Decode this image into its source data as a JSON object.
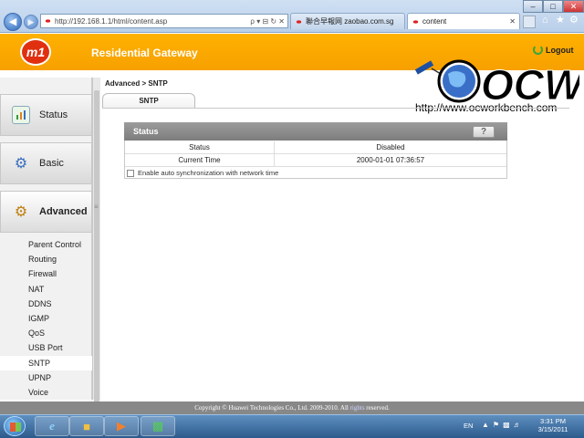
{
  "browser": {
    "url": "http://192.168.1.1/html/content.asp",
    "tab1_label": "聯合早報网 zaobao.com.sg",
    "tab2_label": "content",
    "search_glyphs": "ρ ▾ ⊟ ↻ ✕"
  },
  "router": {
    "title": "Residential Gateway",
    "logo_text": "m1",
    "logout_label": "Logout"
  },
  "watermark": {
    "brand": "OCW",
    "url": "http://www.ocworkbench.com"
  },
  "sidebar": {
    "main_items": [
      {
        "label": "Status",
        "icon": "chart-icon"
      },
      {
        "label": "Basic",
        "icon": "gear-icon"
      },
      {
        "label": "Advanced",
        "icon": "wrench-gear-icon"
      }
    ],
    "sub_items": [
      "Parent Control",
      "Routing",
      "Firewall",
      "NAT",
      "DDNS",
      "IGMP",
      "QoS",
      "USB Port",
      "SNTP",
      "UPNP",
      "Voice"
    ],
    "active_sub": "SNTP"
  },
  "content": {
    "breadcrumb": "Advanced > SNTP",
    "tab_label": "SNTP",
    "panel_title": "Status",
    "help_label": "?",
    "rows": [
      {
        "label": "Status",
        "value": "Disabled"
      },
      {
        "label": "Current Time",
        "value": "2000-01-01 07:36:57"
      }
    ],
    "auto_sync_label": "Enable auto synchronization with network time",
    "auto_sync_checked": false
  },
  "footer": {
    "copyright_pre": "Copyright © Huawei Technologies Co., Ltd. 2009-2010. All",
    "copyright_rights": "rights",
    "copyright_post": "reserved."
  },
  "taskbar": {
    "lang": "EN",
    "time": "3:31 PM",
    "date": "3/15/2011"
  },
  "colors": {
    "header_orange": "#f7a000",
    "footer_gray": "#888888",
    "panel_header": "#8a8a8a"
  }
}
